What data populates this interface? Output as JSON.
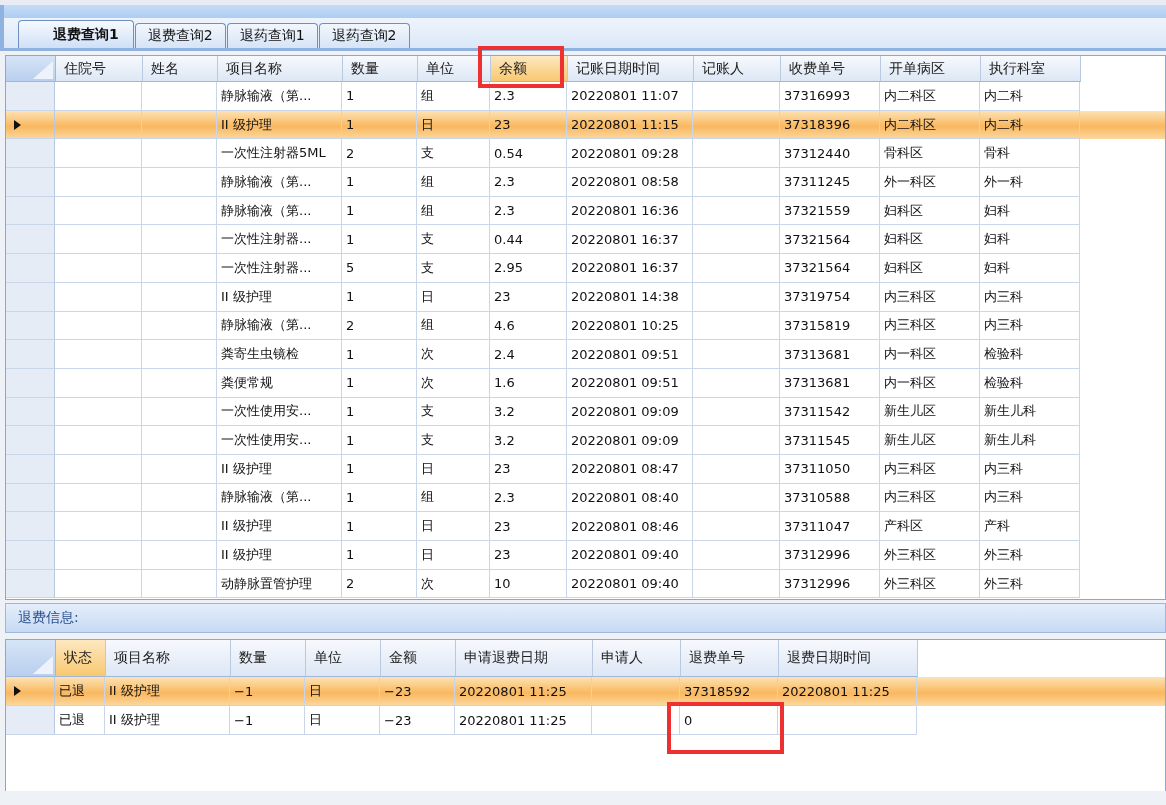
{
  "tabs": [
    {
      "label": "退费查询1",
      "selected": true
    },
    {
      "label": "退费查询2",
      "selected": false
    },
    {
      "label": "退药查询1",
      "selected": false
    },
    {
      "label": "退药查询2",
      "selected": false
    }
  ],
  "charges_table": {
    "columns": [
      {
        "label": "住院号",
        "highlighted": false,
        "marked": false
      },
      {
        "label": "姓名",
        "highlighted": false,
        "marked": false
      },
      {
        "label": "项目名称",
        "highlighted": false,
        "marked": false
      },
      {
        "label": "数量",
        "highlighted": false,
        "marked": false
      },
      {
        "label": "单位",
        "highlighted": false,
        "marked": false
      },
      {
        "label": "余额",
        "highlighted": true,
        "marked": true
      },
      {
        "label": "记账日期时间",
        "highlighted": false,
        "marked": false
      },
      {
        "label": "记账人",
        "highlighted": false,
        "marked": false
      },
      {
        "label": "收费单号",
        "highlighted": false,
        "marked": false
      },
      {
        "label": "开单病区",
        "highlighted": false,
        "marked": false
      },
      {
        "label": "执行科室",
        "highlighted": false,
        "marked": false
      }
    ],
    "rows": [
      {
        "selected": false,
        "cells": [
          null,
          null,
          "静脉输液（第...",
          "1",
          "组",
          "2.3",
          "20220801 11:07",
          null,
          "37316993",
          "内二科区",
          "内二科"
        ]
      },
      {
        "selected": true,
        "cells": [
          null,
          null,
          "II 级护理",
          "1",
          "日",
          "23",
          "20220801 11:15",
          null,
          "37318396",
          "内二科区",
          "内二科"
        ]
      },
      {
        "selected": false,
        "cells": [
          null,
          null,
          "一次性注射器5ML",
          "2",
          "支",
          "0.54",
          "20220801 09:28",
          null,
          "37312440",
          "骨科区",
          "骨科"
        ]
      },
      {
        "selected": false,
        "cells": [
          null,
          null,
          "静脉输液（第...",
          "1",
          "组",
          "2.3",
          "20220801 08:58",
          null,
          "37311245",
          "外一科区",
          "外一科"
        ]
      },
      {
        "selected": false,
        "cells": [
          null,
          null,
          "静脉输液（第...",
          "1",
          "组",
          "2.3",
          "20220801 16:36",
          null,
          "37321559",
          "妇科区",
          "妇科"
        ]
      },
      {
        "selected": false,
        "cells": [
          null,
          null,
          "一次性注射器...",
          "1",
          "支",
          "0.44",
          "20220801 16:37",
          null,
          "37321564",
          "妇科区",
          "妇科"
        ]
      },
      {
        "selected": false,
        "cells": [
          null,
          null,
          "一次性注射器...",
          "5",
          "支",
          "2.95",
          "20220801 16:37",
          null,
          "37321564",
          "妇科区",
          "妇科"
        ]
      },
      {
        "selected": false,
        "cells": [
          null,
          null,
          "II 级护理",
          "1",
          "日",
          "23",
          "20220801 14:38",
          null,
          "37319754",
          "内三科区",
          "内三科"
        ]
      },
      {
        "selected": false,
        "cells": [
          null,
          null,
          "静脉输液（第...",
          "2",
          "组",
          "4.6",
          "20220801 10:25",
          null,
          "37315819",
          "内三科区",
          "内三科"
        ]
      },
      {
        "selected": false,
        "cells": [
          null,
          null,
          "粪寄生虫镜检",
          "1",
          "次",
          "2.4",
          "20220801 09:51",
          null,
          "37313681",
          "内一科区",
          "检验科"
        ]
      },
      {
        "selected": false,
        "cells": [
          null,
          null,
          "粪便常规",
          "1",
          "次",
          "1.6",
          "20220801 09:51",
          null,
          "37313681",
          "内一科区",
          "检验科"
        ]
      },
      {
        "selected": false,
        "cells": [
          null,
          null,
          "一次性使用安...",
          "1",
          "支",
          "3.2",
          "20220801 09:09",
          null,
          "37311542",
          "新生儿区",
          "新生儿科"
        ]
      },
      {
        "selected": false,
        "cells": [
          null,
          null,
          "一次性使用安...",
          "1",
          "支",
          "3.2",
          "20220801 09:09",
          null,
          "37311545",
          "新生儿区",
          "新生儿科"
        ]
      },
      {
        "selected": false,
        "cells": [
          null,
          null,
          "II 级护理",
          "1",
          "日",
          "23",
          "20220801 08:47",
          null,
          "37311050",
          "内三科区",
          "内三科"
        ]
      },
      {
        "selected": false,
        "cells": [
          null,
          null,
          "静脉输液（第...",
          "1",
          "组",
          "2.3",
          "20220801 08:40",
          null,
          "37310588",
          "内三科区",
          "内三科"
        ]
      },
      {
        "selected": false,
        "cells": [
          null,
          null,
          "II 级护理",
          "1",
          "日",
          "23",
          "20220801 08:46",
          null,
          "37311047",
          "产科区",
          "产科"
        ]
      },
      {
        "selected": false,
        "cells": [
          null,
          null,
          "II 级护理",
          "1",
          "日",
          "23",
          "20220801 09:40",
          null,
          "37312996",
          "外三科区",
          "外三科"
        ]
      },
      {
        "selected": false,
        "cells": [
          null,
          null,
          "动静脉置管护理",
          "2",
          "次",
          "10",
          "20220801 09:40",
          null,
          "37312996",
          "外三科区",
          "外三科"
        ]
      }
    ]
  },
  "refund_section": {
    "title": "退费信息:"
  },
  "refund_table": {
    "columns": [
      {
        "label": "状态",
        "highlighted": true
      },
      {
        "label": "项目名称",
        "highlighted": false
      },
      {
        "label": "数量",
        "highlighted": false
      },
      {
        "label": "单位",
        "highlighted": false
      },
      {
        "label": "金额",
        "highlighted": false
      },
      {
        "label": "申请退费日期",
        "highlighted": false
      },
      {
        "label": "申请人",
        "highlighted": false
      },
      {
        "label": "退费单号",
        "highlighted": false,
        "frames_cells": true
      },
      {
        "label": "退费日期时间",
        "highlighted": false
      }
    ],
    "rows": [
      {
        "selected": true,
        "cells": [
          "已退",
          "II 级护理",
          "−1",
          "日",
          "−23",
          "20220801 11:25",
          null,
          "37318592",
          "20220801 11:25"
        ],
        "marked": false
      },
      {
        "selected": false,
        "cells": [
          "已退",
          "II 级护理",
          "−1",
          "日",
          "−23",
          "20220801 11:25",
          null,
          "0",
          null
        ],
        "marked": true
      }
    ]
  }
}
